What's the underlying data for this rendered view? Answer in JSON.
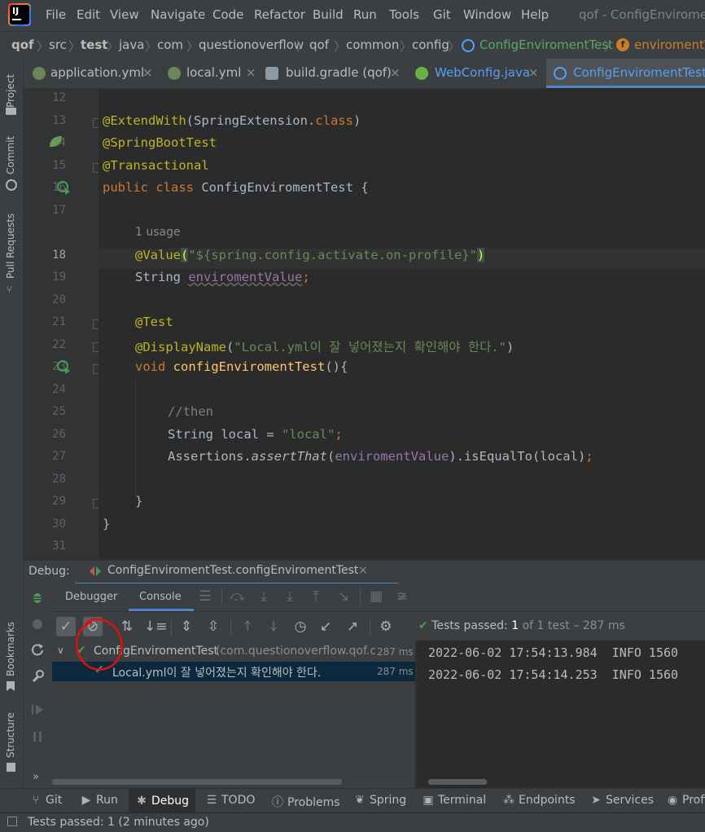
{
  "window": {
    "title": "qof - ConfigEnviromen"
  },
  "menu": [
    "File",
    "Edit",
    "View",
    "Navigate",
    "Code",
    "Refactor",
    "Build",
    "Run",
    "Tools",
    "Git",
    "Window",
    "Help"
  ],
  "breadcrumb": [
    "qof",
    "src",
    "test",
    "java",
    "com",
    "questionoverflow",
    "qof",
    "common",
    "config",
    "ConfigEnviromentTest",
    "enviromentV"
  ],
  "left_tabs": [
    "Project",
    "Commit",
    "Pull Requests",
    "Bookmarks",
    "Structure"
  ],
  "tabs": [
    {
      "label": "application.yml",
      "closable": "×"
    },
    {
      "label": "local.yml",
      "closable": "×"
    },
    {
      "label": "build.gradle (qof)",
      "closable": "×"
    },
    {
      "label": "WebConfig.java",
      "closable": "×"
    },
    {
      "label": "ConfigEnviromentTest.ja"
    }
  ],
  "editor": {
    "line_numbers": [
      "12",
      "13",
      "14",
      "15",
      "16",
      "17",
      "18",
      "19",
      "20",
      "21",
      "22",
      "23",
      "24",
      "25",
      "26",
      "27",
      "28",
      "29",
      "30",
      "31"
    ],
    "usage_hint": "1 usage",
    "code": {
      "l13_ann": "@ExtendWith",
      "l13_a": "(SpringExtension.",
      "l13_kw": "class",
      "l13_b": ")",
      "l14": "@SpringBootTest",
      "l15": "@Transactional",
      "l16_kw": "public class ",
      "l16_name": "ConfigEnviromentTest {",
      "l18_ann": "@Value",
      "l18_p1": "(",
      "l18_str": "\"${spring.config.activate.on-profile}\"",
      "l18_p2": ")",
      "l19_type": "String ",
      "l19_field": "enviromentValue",
      "l19_semi": ";",
      "l21": "@Test",
      "l22_ann": "@DisplayName",
      "l22_p1": "(",
      "l22_str": "\"Local.yml이 잘 넣어졌는지 확인해야 한다.\"",
      "l22_p2": ")",
      "l23_kw": "void ",
      "l23_fn": "configEnviromentTest",
      "l23_rest": "(){",
      "l25": "//then",
      "l26_a": "String local = ",
      "l26_str": "\"local\"",
      "l26_semi": ";",
      "l27_a": "Assertions.",
      "l27_fn": "assertThat",
      "l27_b": "(",
      "l27_field": "enviromentValue",
      "l27_c": ").isEqualTo(local)",
      "l27_semi": ";",
      "l29": "}",
      "l30": "}"
    }
  },
  "debug": {
    "label": "Debug:",
    "config_tab": "ConfigEnviromentTest.configEnviromentTest",
    "config_close": "×",
    "tabs": [
      "Debugger",
      "Console"
    ],
    "status": {
      "prefix": "Tests passed: ",
      "count": "1",
      "suffix": " of 1 test – 287 ms"
    },
    "tree": [
      {
        "name": "ConfigEnviromentTest",
        "package": " (com.questionoverflow.qof.c",
        "time": "287 ms"
      },
      {
        "name": "Local.yml이 잘 넣어졌는지 확인해야 한다.",
        "time": "287 ms"
      }
    ],
    "console_lines": [
      "2022-06-02 17:54:13.984  INFO 1560",
      "2022-06-02 17:54:14.253  INFO 1560"
    ],
    "more": "»"
  },
  "tool_windows": [
    "Git",
    "Run",
    "Debug",
    "TODO",
    "Problems",
    "Spring",
    "Terminal",
    "Endpoints",
    "Services",
    "Profi"
  ],
  "statusbar": {
    "text": "Tests passed: 1 (2 minutes ago)"
  },
  "colors": {
    "accent_check": "#499c54",
    "annotation": "#bbb529",
    "keyword": "#cc7832",
    "string": "#6a8759",
    "field": "#9876aa",
    "highlight_circle": "#e01010"
  }
}
